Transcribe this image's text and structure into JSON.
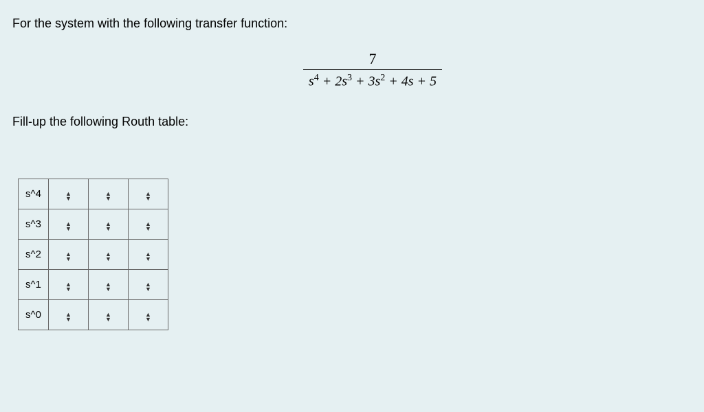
{
  "prompt1": "For the system with the following transfer function:",
  "formula": {
    "numerator": "7",
    "denominator_html": "s<sup>4</sup> + 2s<sup>3</sup> + 3s<sup>2</sup> + 4s + 5"
  },
  "prompt2": "Fill-up the following Routh table:",
  "rows": [
    {
      "label": "s^4"
    },
    {
      "label": "s^3"
    },
    {
      "label": "s^2"
    },
    {
      "label": "s^1"
    },
    {
      "label": "s^0"
    }
  ],
  "columns": 3
}
